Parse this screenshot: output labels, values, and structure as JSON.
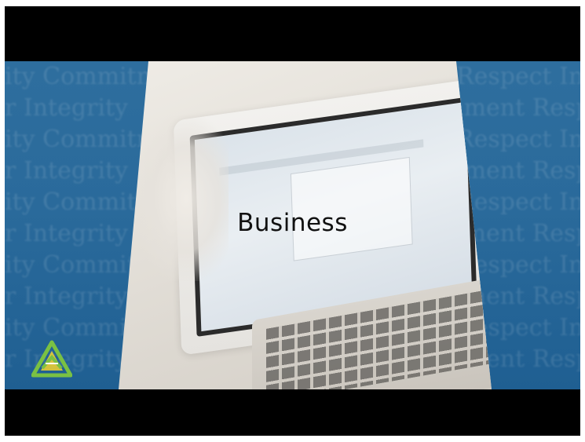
{
  "slide": {
    "title": "Business",
    "background_words_left": [
      "ity Commitm",
      "r Integrity",
      "ity Commitm",
      "r Integrity",
      "ity Commitm",
      "r Integrity",
      "ity Commitm",
      "r Integrity",
      "ity Commitm",
      "r Integrity"
    ],
    "background_words_right": [
      "Respect Inte",
      "iment Respe",
      "Respect Inte",
      "iment Respe",
      "Respect Inte",
      "iment Respe",
      "Respect Inte",
      "iment Respe",
      "Respect Inte",
      "iment Respe"
    ]
  },
  "colors": {
    "letterbox": "#000000",
    "stage_blue": "#2a6a9b",
    "logo_green": "#7ac143",
    "logo_yellow": "#f2d22e"
  },
  "icons": {
    "logo": "company-triangle-logo"
  }
}
